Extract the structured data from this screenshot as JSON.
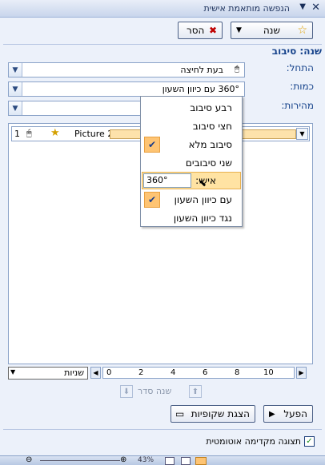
{
  "title": "הנפשה מותאמת אישית",
  "buttons": {
    "change": "שנה",
    "remove": "הסר",
    "play": "הפעל",
    "slideshow": "הצגת שקופיות"
  },
  "section_title": "שנה: סיבוב",
  "fields": [
    {
      "label": "התחל:",
      "value": "בעת לחיצה"
    },
    {
      "label": "כמות:",
      "value": "360° עם כיוון השעון"
    },
    {
      "label": "מהירות:",
      "value": ""
    }
  ],
  "list_item": {
    "num": "1",
    "name": "Picture 2"
  },
  "menu": {
    "items": [
      {
        "label": "רבע סיבוב",
        "checked": false
      },
      {
        "label": "חצי סיבוב",
        "checked": false
      },
      {
        "label": "סיבוב מלא",
        "checked": true
      },
      {
        "label": "שני סיבובים",
        "checked": false
      }
    ],
    "custom_label": "אישי:",
    "custom_value": "360°",
    "direction_items": [
      {
        "label": "עם כיוון השעון",
        "checked": true
      },
      {
        "label": "נגד כיוון השעון",
        "checked": false
      }
    ]
  },
  "timeline": {
    "dropdown": "שניות",
    "ticks": [
      "0",
      "2",
      "4",
      "6",
      "8",
      "10"
    ]
  },
  "reorder_label": "שנה סדר",
  "autopreview_label": "תצוגה מקדימה אוטומטית",
  "statusbar": {
    "zoom": "43%"
  }
}
